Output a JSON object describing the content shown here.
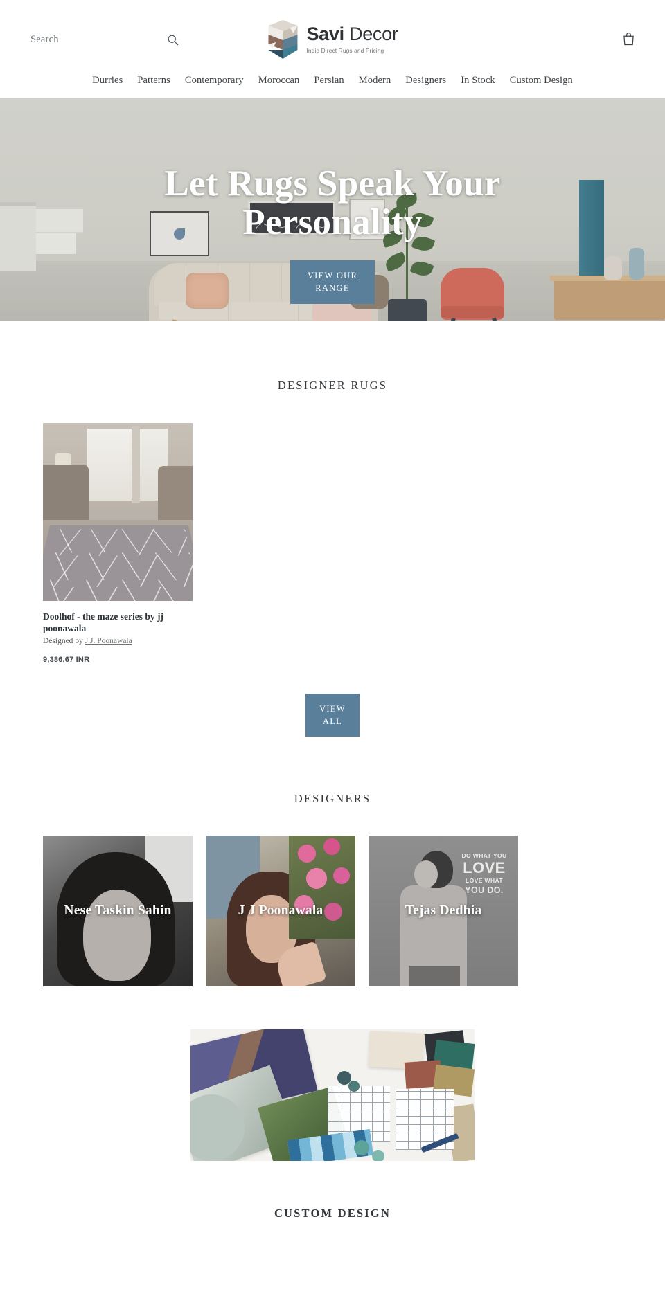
{
  "header": {
    "search": {
      "placeholder": "Search",
      "value": "",
      "icon": "search-icon"
    },
    "logo": {
      "name_bold": "Savi",
      "name_light": " Decor",
      "tagline": "India Direct Rugs and Pricing",
      "icon": "savi-logo-mark"
    },
    "cart": {
      "icon": "shopping-bag-icon",
      "label": "Cart"
    },
    "nav": [
      {
        "label": "Durries"
      },
      {
        "label": "Patterns"
      },
      {
        "label": "Contemporary"
      },
      {
        "label": "Moroccan"
      },
      {
        "label": "Persian"
      },
      {
        "label": "Modern"
      },
      {
        "label": "Designers"
      },
      {
        "label": "In Stock"
      },
      {
        "label": "Custom Design"
      }
    ]
  },
  "hero": {
    "title": "Let Rugs Speak Your Personality",
    "cta_label": "VIEW OUR RANGE",
    "cta_color": "#5a7f9b",
    "image_alt": "living-room-with-teal-rug"
  },
  "designer_rugs": {
    "heading": "DESIGNER RUGS",
    "products": [
      {
        "title": "Doolhof - the maze series by jj poonawala",
        "designed_by_prefix": "Designed by ",
        "designer": "J.J. Poonawala",
        "price": "9,386.67 INR",
        "image_alt": "grey-maze-pattern-rug-in-living-room"
      }
    ],
    "view_all_label": "VIEW ALL"
  },
  "designers": {
    "heading": "DESIGNERS",
    "cards": [
      {
        "name": "Nese Taskin Sahin",
        "image_alt": "portrait-nese-taskin-sahin"
      },
      {
        "name": "J J Poonawala",
        "image_alt": "portrait-jj-poonawala-with-flowers"
      },
      {
        "name": "Tejas Dedhia",
        "image_alt": "portrait-tejas-dedhia-do-what-you-love-wall"
      }
    ]
  },
  "custom_design": {
    "heading": "CUSTOM DESIGN",
    "image_alt": "moodboard-with-swatches-floorplans-and-paint-chips",
    "wall_quote": {
      "line1": "DO WHAT YOU",
      "line2": "LOVE",
      "line3": "LOVE WHAT",
      "line4": "YOU DO."
    }
  },
  "colors": {
    "accent": "#5a7f9b",
    "text": "#3d4246",
    "heading": "#32373b"
  }
}
